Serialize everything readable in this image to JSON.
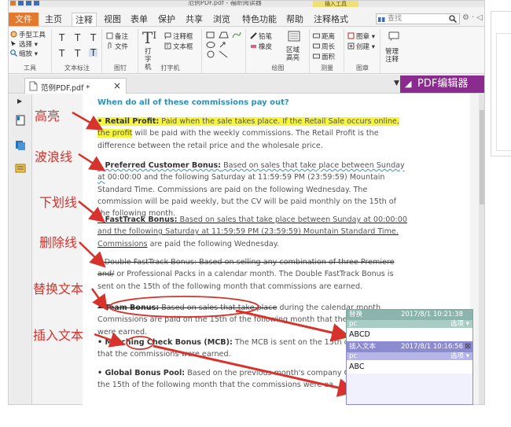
{
  "titlebar": {
    "title": "范例PDF.pdf - 福昕阅读器",
    "context_tab": "插入工具"
  },
  "menu": {
    "tabs": [
      "文件",
      "主页",
      "注释",
      "视图",
      "表单",
      "保护",
      "共享",
      "浏览",
      "特色功能",
      "帮助",
      "注释格式"
    ],
    "active": "注释"
  },
  "search": {
    "placeholder": "查找"
  },
  "ribbon": {
    "tools": {
      "hand": "手型工具",
      "select": "选择",
      "zoom": "缩放",
      "label": "工具"
    },
    "text_markup": {
      "label": "文本标注"
    },
    "pin": {
      "note": "备注",
      "file": "文件",
      "label": "图钉"
    },
    "typewriter": {
      "typewriter": "打字机",
      "callout": "注释框",
      "textbox": "文本框",
      "label": "打字机"
    },
    "drawing": {
      "pencil": "铅笔",
      "eraser": "橡皮",
      "area_highlight": "区域高亮",
      "label": "绘图"
    },
    "measure": {
      "distance": "距离",
      "perimeter": "周长",
      "area": "面积",
      "label": "测量"
    },
    "stamp": {
      "stamp": "图章",
      "create": "创建",
      "label": "图章"
    },
    "manage": {
      "label": "管理注释"
    }
  },
  "doc": {
    "filename": "范例PDF.pdf *",
    "close": "×"
  },
  "editor_button": "PDF编辑器",
  "content": {
    "heading": "When do all of these commissions pay out?",
    "p1_bold": "• Retail Profit:",
    "p1_hl": " Paid when the sale takes place. If the Retail Sale occurs online, the profit",
    "p1_rest": "will be paid with the weekly commissions. The Retail Profit is the difference between the retail price and the wholesale price.",
    "p2_bold": "• Preferred Customer Bonus:",
    "p2_wavy": " Based on sales that take place between Sunday at",
    "p2_rest": "00:00:00 and the following Saturday at 11:59:59 PM (23:59:59) Mountain Standard Time. Commissions are paid on the following Wednesday. The commission will be paid weekly, but the CV will be paid monthly on the 15th of the following month.",
    "p3_bold": "• FastTrack Bonus:",
    "p3_ul": " Based on sales that take place between Sunday at 00:00:00 and the following Saturday at 11:59:59 PM (23:59:59) Mountain Standard Time. Commissions",
    "p3_rest": "are paid the following Wednesday.",
    "p4_st": "• Double FastTrack Bonus: Based on selling any combination of three Premiere and/",
    "p4_rest": "or Professional Packs in a calendar month. The Double FastTrack Bonus is sent on the 15th of the following month that commissions are earned.",
    "p5_st_b": "• Team Bonus:",
    "p5_st": " Based on sales that take place",
    "p5_rest": " during the calendar month. Commissions are paid on the 15th of the following month that the commissions were earned.",
    "p6_bold": "• Matching Check Bonus (MCB):",
    "p6_rest": " The MCB is sent on the 15th of the month that the commissions were earned.",
    "p7_bold": "• Global Bonus Pool:",
    "p7_rest": " Based on the previous month's company Global paid on the 15th of the following month that the commissions were ea"
  },
  "annotation_labels": [
    "高亮",
    "波浪线",
    "下划线",
    "删除线",
    "替换文本",
    "插入文本"
  ],
  "comments": [
    {
      "type": "替换",
      "author": "pc",
      "datetime": "2017/8/1 10:21:38",
      "options": "选项 ▾",
      "text": "ABCD"
    },
    {
      "type": "插入文本",
      "author": "pc",
      "datetime": "2017/8/1 10:16:56",
      "options": "选项 ▾",
      "text": "ABC"
    }
  ],
  "colors": {
    "accent": "#e2792c",
    "editor": "#8b2b8f",
    "label_red": "#d7322b",
    "heading_blue": "#2e8fb8"
  }
}
